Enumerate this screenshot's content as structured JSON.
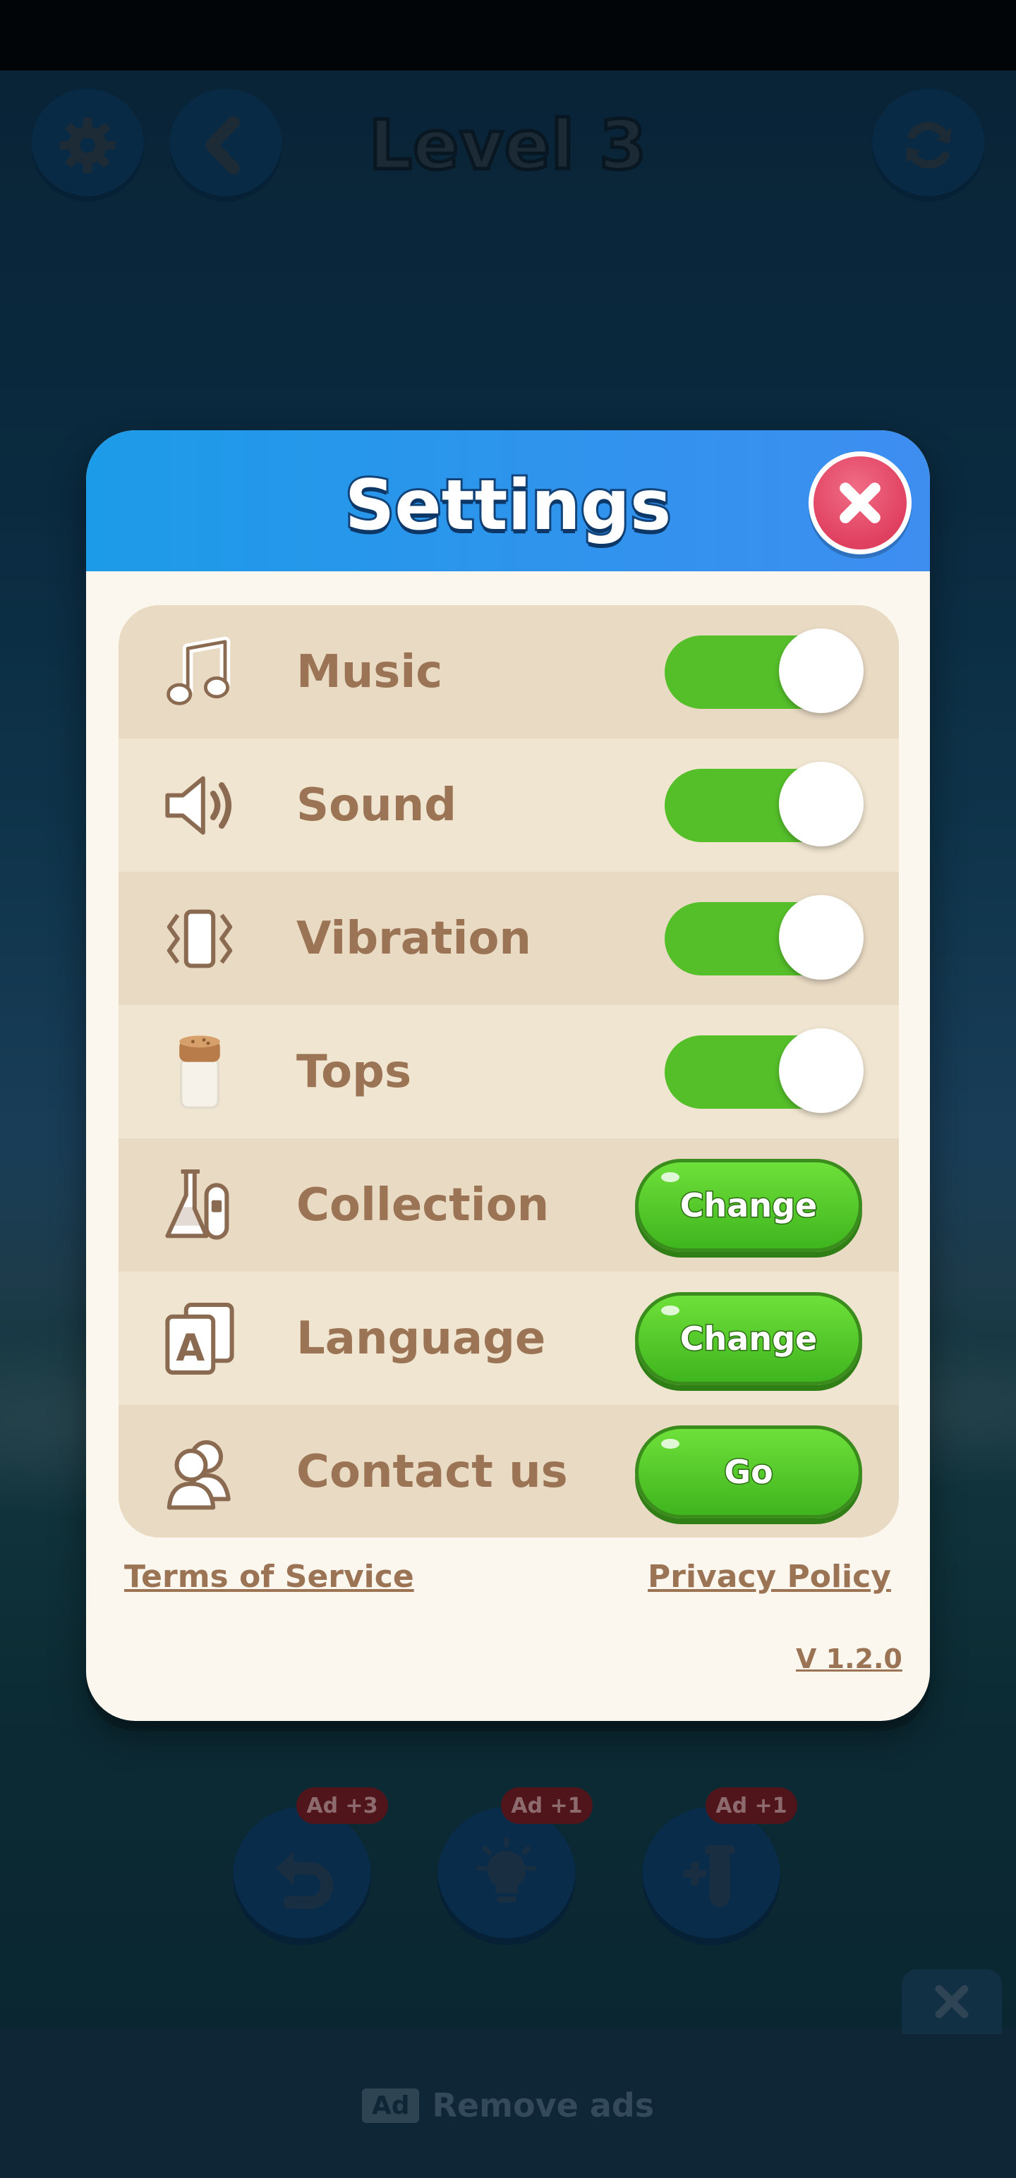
{
  "hud": {
    "level_title": "Level 3"
  },
  "settings": {
    "title": "Settings",
    "rows": [
      {
        "label": "Music",
        "control": "toggle",
        "on": true
      },
      {
        "label": "Sound",
        "control": "toggle",
        "on": true
      },
      {
        "label": "Vibration",
        "control": "toggle",
        "on": true
      },
      {
        "label": "Tops",
        "control": "toggle",
        "on": true
      },
      {
        "label": "Collection",
        "control": "button",
        "button_label": "Change"
      },
      {
        "label": "Language",
        "control": "button",
        "button_label": "Change"
      },
      {
        "label": "Contact us",
        "control": "button",
        "button_label": "Go"
      }
    ],
    "terms_link": "Terms of Service",
    "privacy_link": "Privacy Policy",
    "version": "V 1.2.0"
  },
  "boosters": [
    {
      "name": "undo",
      "badge": "Ad +3"
    },
    {
      "name": "hint",
      "badge": "Ad +1"
    },
    {
      "name": "add-tube",
      "badge": "Ad +1"
    }
  ],
  "ads_bar": {
    "ad_tag": "Ad",
    "remove_ads_label": "Remove ads"
  },
  "colors": {
    "header_blue": "#2196ea",
    "toggle_green": "#55bf2a",
    "button_green": "#4cc424",
    "label_brown": "#9a7454",
    "close_pink": "#e84a67"
  }
}
